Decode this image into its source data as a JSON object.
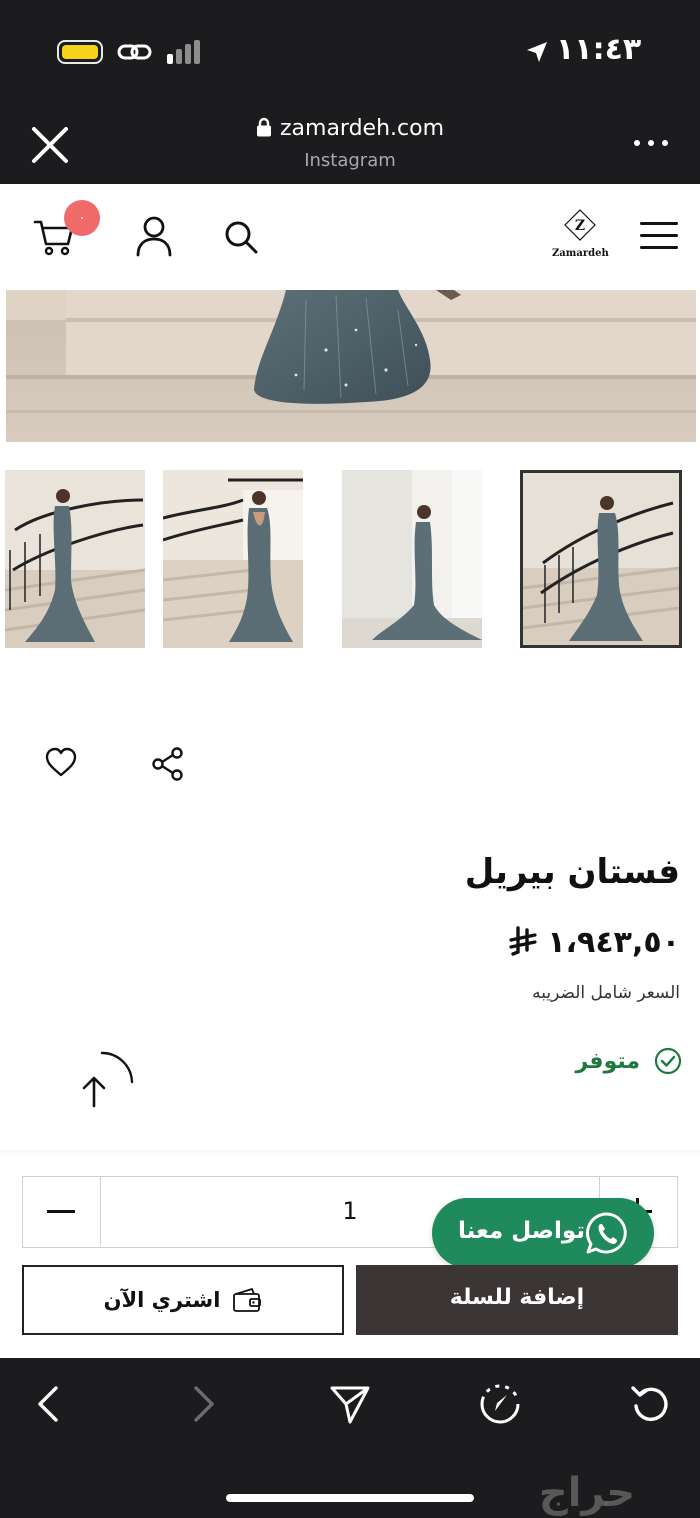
{
  "status_bar": {
    "time": "١١:٤٣",
    "battery_color": "#f5d21c"
  },
  "browser": {
    "url": "zamardeh.com",
    "source": "Instagram"
  },
  "site": {
    "brand": "Zamardeh",
    "logo_letter": "Z",
    "cart_count": "٠",
    "badge_color": "#f06a6a"
  },
  "product": {
    "title": "فستان بيريل",
    "price": "١،٩٤٣,٥٠",
    "tax_note": "السعر شامل الضريبه",
    "availability": "متوفر",
    "availability_color": "#1e7a3c",
    "gallery_count": 4,
    "selected_thumbnail_index": 3
  },
  "cart": {
    "quantity": "1",
    "buy_now_label": "اشتري الآن",
    "add_to_cart_label": "إضافة للسلة"
  },
  "whatsapp": {
    "label": "تواصل معنا",
    "color": "#1f8a5b"
  },
  "icons": {
    "close": "close-icon",
    "more": "more-icon",
    "cart": "cart-icon",
    "user": "user-icon",
    "search": "search-icon",
    "menu": "menu-icon",
    "wishlist": "heart-icon",
    "share": "share-icon",
    "scroll_top": "arrow-up-icon",
    "back": "chevron-left-icon",
    "forward": "chevron-right-icon",
    "send": "send-icon",
    "compass": "compass-icon",
    "reload": "reload-icon"
  },
  "watermark": {
    "text": "حراج"
  }
}
